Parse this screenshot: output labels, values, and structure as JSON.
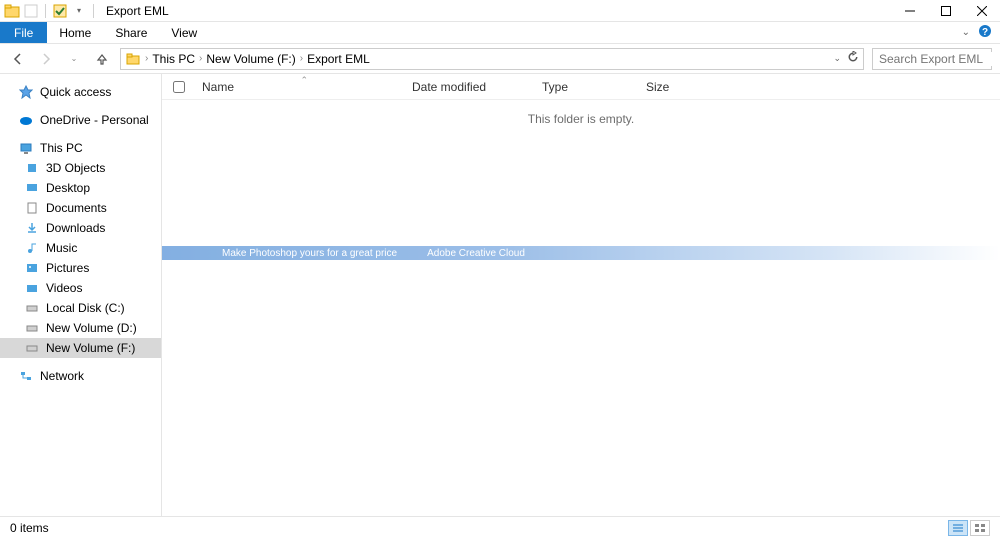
{
  "title": "Export EML",
  "ribbon": {
    "file": "File",
    "tabs": [
      "Home",
      "Share",
      "View"
    ]
  },
  "breadcrumb": [
    "This PC",
    "New Volume (F:)",
    "Export EML"
  ],
  "search_placeholder": "Search Export EML",
  "columns": {
    "name": "Name",
    "date": "Date modified",
    "type": "Type",
    "size": "Size"
  },
  "empty_message": "This folder is empty.",
  "sidebar": {
    "quick_access": "Quick access",
    "onedrive": "OneDrive - Personal",
    "this_pc": "This PC",
    "pc_items": [
      "3D Objects",
      "Desktop",
      "Documents",
      "Downloads",
      "Music",
      "Pictures",
      "Videos",
      "Local Disk (C:)",
      "New Volume (D:)",
      "New Volume (F:)"
    ],
    "network": "Network"
  },
  "banner": {
    "text1": "Make Photoshop yours for a great price",
    "text2": "Adobe Creative Cloud",
    "text3": ""
  },
  "status": {
    "items": "0 items"
  }
}
